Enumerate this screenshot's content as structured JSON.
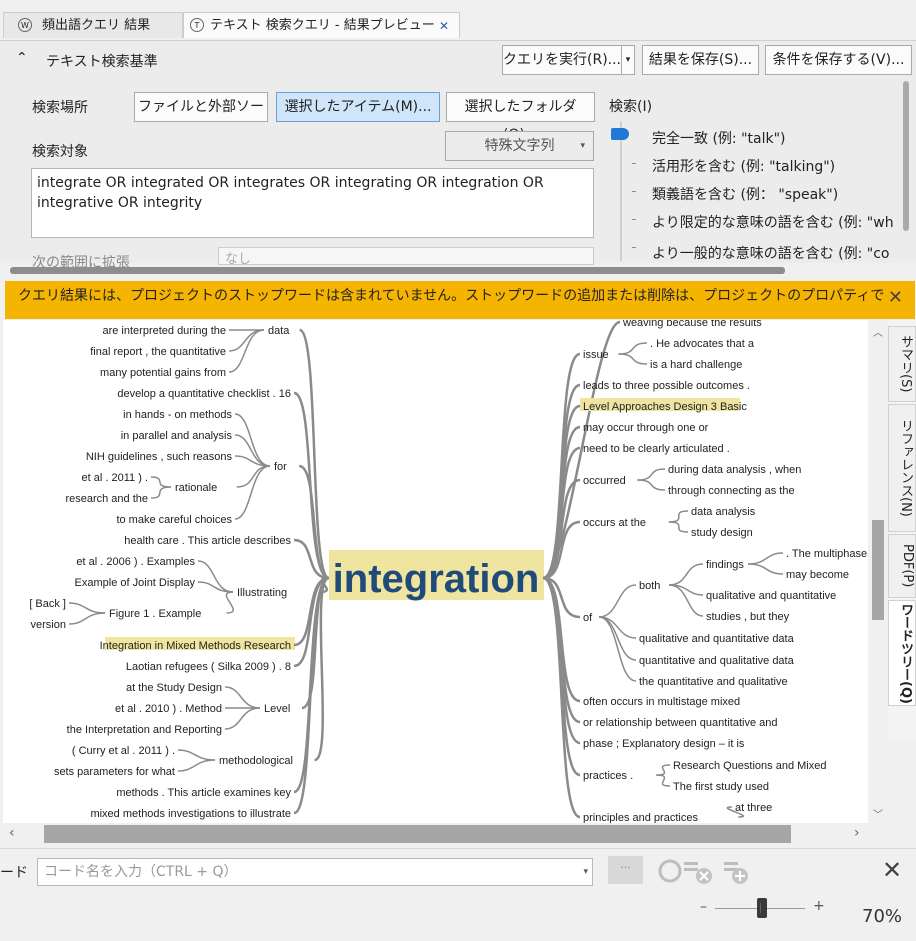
{
  "tabs": [
    {
      "label": "頻出語クエリ 結果",
      "icon": "word-query-icon"
    },
    {
      "label": "テキスト 検索クエリ - 結果プレビュー",
      "icon": "text-query-icon"
    }
  ],
  "criteria": {
    "title": "テキスト検索基準",
    "run_label": "クエリを実行(R)...",
    "save_results_label": "結果を保存(S)...",
    "save_criteria_label": "条件を保存する(V)...",
    "search_location_label": "検索場所",
    "loc_buttons": [
      "ファイルと外部ソー",
      "選択したアイテム(M)...",
      "選択したフォルダ(O)..."
    ],
    "search_target_label": "検索対象",
    "special_chars_label": "特殊文字列",
    "query_text": "integrate OR  integrated OR  integrates OR  integrating OR  integration OR  integrative OR  integrity",
    "extend_label": "次の範囲に拡張",
    "extend_value": "なし",
    "search_label": "検索(I)",
    "options": [
      "完全一致 (例: \"talk\")",
      "活用形を含む (例: \"talking\")",
      "類義語を含む (例： \"speak\")",
      "より限定的な意味の語を含む (例: \"wh",
      "より一般的な意味の語を含む (例: \"co"
    ]
  },
  "banner": {
    "text": "クエリ結果には、プロジェクトのストップワードは含まれていません。ストップワードの追加または削除は、プロジェクトのプロパティで"
  },
  "tree": {
    "center": "integration",
    "left_nodes": [
      {
        "label": "data",
        "children": [
          "are interpreted during the",
          "final report , the quantitative",
          "many potential gains from"
        ]
      },
      {
        "label": "",
        "children": [
          "develop a quantitative checklist . 16"
        ]
      },
      {
        "label": "for",
        "children": [
          "in hands - on methods",
          "in parallel and analysis",
          "NIH guidelines , such reasons",
          "et al . 2011 ) .",
          "research and the",
          "to make careful choices"
        ],
        "sub": {
          "label": "rationale"
        }
      },
      {
        "label": "Illustrating",
        "children": [
          "health care . This article describes",
          "et al . 2006 ) . Examples",
          "Example of Joint Display",
          "[ Back ]",
          "version"
        ],
        "sub": {
          "label": "Figure 1 . Example"
        }
      },
      {
        "label": "",
        "children": [
          "Integration in Mixed Methods Research",
          "Laotian refugees ( Silka 2009 ) . 8"
        ]
      },
      {
        "label": "Level",
        "children": [
          "at the Study Design",
          "et al . 2010 ) . Method",
          "the Interpretation and Reporting"
        ]
      },
      {
        "label": "methodological",
        "children": [
          "( Curry et al . 2011 ) .",
          "sets parameters for what"
        ]
      },
      {
        "label": "",
        "children": [
          "methods . This article examines key",
          "mixed methods investigations to illustrate"
        ]
      }
    ],
    "right_nodes": [
      {
        "label": "",
        "children": [
          "weaving because the results"
        ]
      },
      {
        "label": "issue",
        "children": [
          ". He advocates that a",
          "is a hard challenge"
        ]
      },
      {
        "label": "",
        "children": [
          "leads to three possible outcomes .",
          "Level Approaches Design 3 Basic",
          "may occur through one or",
          "need to be clearly articulated ."
        ]
      },
      {
        "label": "occurred",
        "children": [
          "during data analysis , when",
          "through connecting as the"
        ]
      },
      {
        "label": "occurs at the",
        "children": [
          "data analysis",
          "study design"
        ]
      },
      {
        "label": "of",
        "children": [
          "both",
          "qualitative and quantitative data",
          "quantitative and qualitative data",
          "the quantitative and qualitative"
        ]
      },
      {
        "label": "both",
        "children": [
          "findings",
          "qualitative and quantitative",
          "studies , but they"
        ]
      },
      {
        "label": "findings",
        "children": [
          ". The multiphase",
          "may become"
        ]
      },
      {
        "label": "",
        "children": [
          "often occurs in multistage mixed",
          "or relationship between quantitative and",
          "phase ; Explanatory design – it is"
        ]
      },
      {
        "label": "practices .",
        "children": [
          "Research Questions and Mixed",
          "The first study used"
        ]
      },
      {
        "label": "principles and practices",
        "children": [
          "at three"
        ]
      }
    ]
  },
  "side_tabs": [
    "サマリ(S)",
    "リファレンス(N)",
    "PDF(P)",
    "ワードツリー(Q)"
  ],
  "bottom": {
    "code_label_partial": "ード",
    "code_placeholder": "コード名を入力（CTRL + Q）",
    "zoom": "70%",
    "zoom_value": 0.5
  },
  "colors": {
    "highlight": "#efe5a0",
    "center_text": "#1f4a7a",
    "banner": "#f5b400",
    "branch": "#8a8a8a"
  }
}
